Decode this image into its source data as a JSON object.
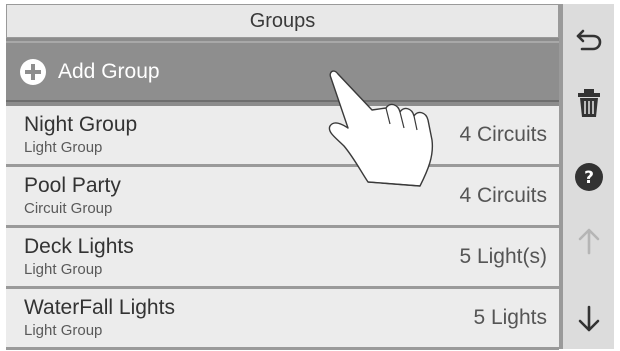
{
  "header": {
    "title": "Groups"
  },
  "add_row": {
    "label": "Add Group",
    "icon": "plus-circle-icon"
  },
  "groups": [
    {
      "name": "Night Group",
      "type": "Light Group",
      "count": "4 Circuits"
    },
    {
      "name": "Pool Party",
      "type": "Circuit Group",
      "count": "4 Circuits"
    },
    {
      "name": "Deck Lights",
      "type": "Light Group",
      "count": "5 Light(s)"
    },
    {
      "name": "WaterFall Lights",
      "type": "Light Group",
      "count": "5 Lights"
    }
  ],
  "sidebar": {
    "buttons": [
      {
        "icon": "back-arrow-icon"
      },
      {
        "icon": "trash-icon"
      },
      {
        "icon": "help-icon"
      },
      {
        "icon": "arrow-up-icon",
        "state": "disabled"
      },
      {
        "icon": "arrow-down-icon"
      }
    ]
  },
  "colors": {
    "header_bg": "#e8e8e8",
    "selected_row_bg": "#8e8e8e",
    "row_bg": "#ececec",
    "sidebar_bg": "#dcdcdc",
    "icon_dark": "#333333",
    "icon_disabled": "#b5b5b5"
  }
}
